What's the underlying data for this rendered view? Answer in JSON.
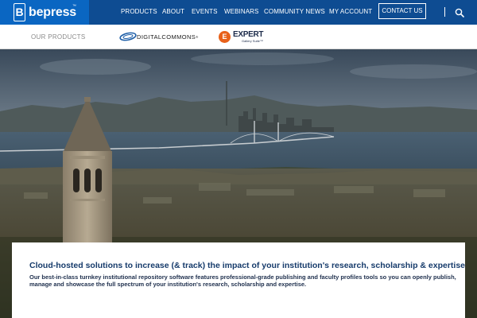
{
  "brand": {
    "name": "bepress",
    "trademark": "™",
    "badge_glyph": "B"
  },
  "nav": {
    "links": [
      "PRODUCTS",
      "ABOUT",
      "EVENTS",
      "WEBINARS",
      "COMMUNITY NEWS",
      "MY ACCOUNT"
    ],
    "contact_label": "CONTACT US",
    "search_icon": "search-icon"
  },
  "products_bar": {
    "label": "OUR PRODUCTS",
    "digital_commons": {
      "text": "DIGITALCOMMONS",
      "registered": "®",
      "swoosh_color": "#1f5fa8"
    },
    "expert": {
      "mark": "E",
      "title": "EXPERT",
      "subtitle": "Gallery Suite",
      "trademark": "™",
      "mark_color": "#e8611a"
    }
  },
  "hero": {
    "card": {
      "heading": "Cloud-hosted solutions to increase (& track) the impact of your institution's research, scholarship & expertise",
      "body": "Our best-in-class turnkey institutional repository software features professional-grade publishing and faculty profiles tools so you can openly publish, manage and showcase the full spectrum of your institution's research, scholarship and expertise."
    }
  },
  "colors": {
    "nav_bg": "#0e4c92",
    "logo_bg": "#0a66c2",
    "heading": "#163b6b",
    "body_text": "#1e2f4d"
  }
}
